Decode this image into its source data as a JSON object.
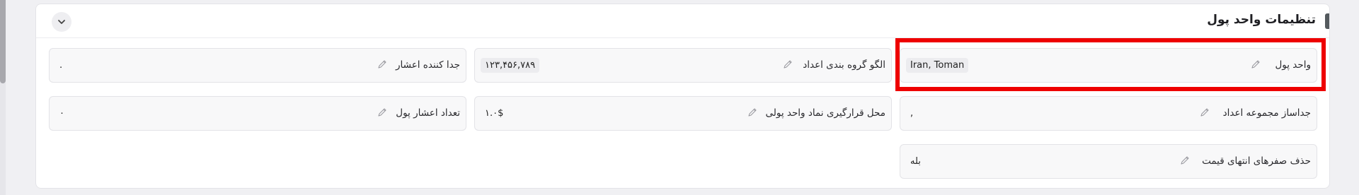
{
  "section": {
    "title": "تنظیمات واحد پول"
  },
  "fields": [
    {
      "id": "currency-unit",
      "label": "واحد پول",
      "value": "Iran, Toman"
    },
    {
      "id": "digit-grouping-pattern",
      "label": "الگو گروه بندی اعداد",
      "value": "۱۲۳,۴۵۶,۷۸۹"
    },
    {
      "id": "decimal-separator",
      "label": "جدا کننده اعشار",
      "value": "."
    },
    {
      "id": "digit-group-separator",
      "label": "جداساز مجموعه اعداد",
      "value": ","
    },
    {
      "id": "currency-symbol-position",
      "label": "محل قرارگیری نماد واحد پولی",
      "value": "۱.۰$"
    },
    {
      "id": "currency-decimal-count",
      "label": "تعداد اعشار پول",
      "value": "۰"
    },
    {
      "id": "remove-trailing-zeros",
      "label": "حذف صفرهای انتهای قیمت",
      "value": "بله"
    }
  ],
  "colors": {
    "highlight": "#ee0000",
    "accent": "#545a5e"
  },
  "icons": {
    "edit": "pencil-icon",
    "collapse": "chevron-down-icon"
  }
}
